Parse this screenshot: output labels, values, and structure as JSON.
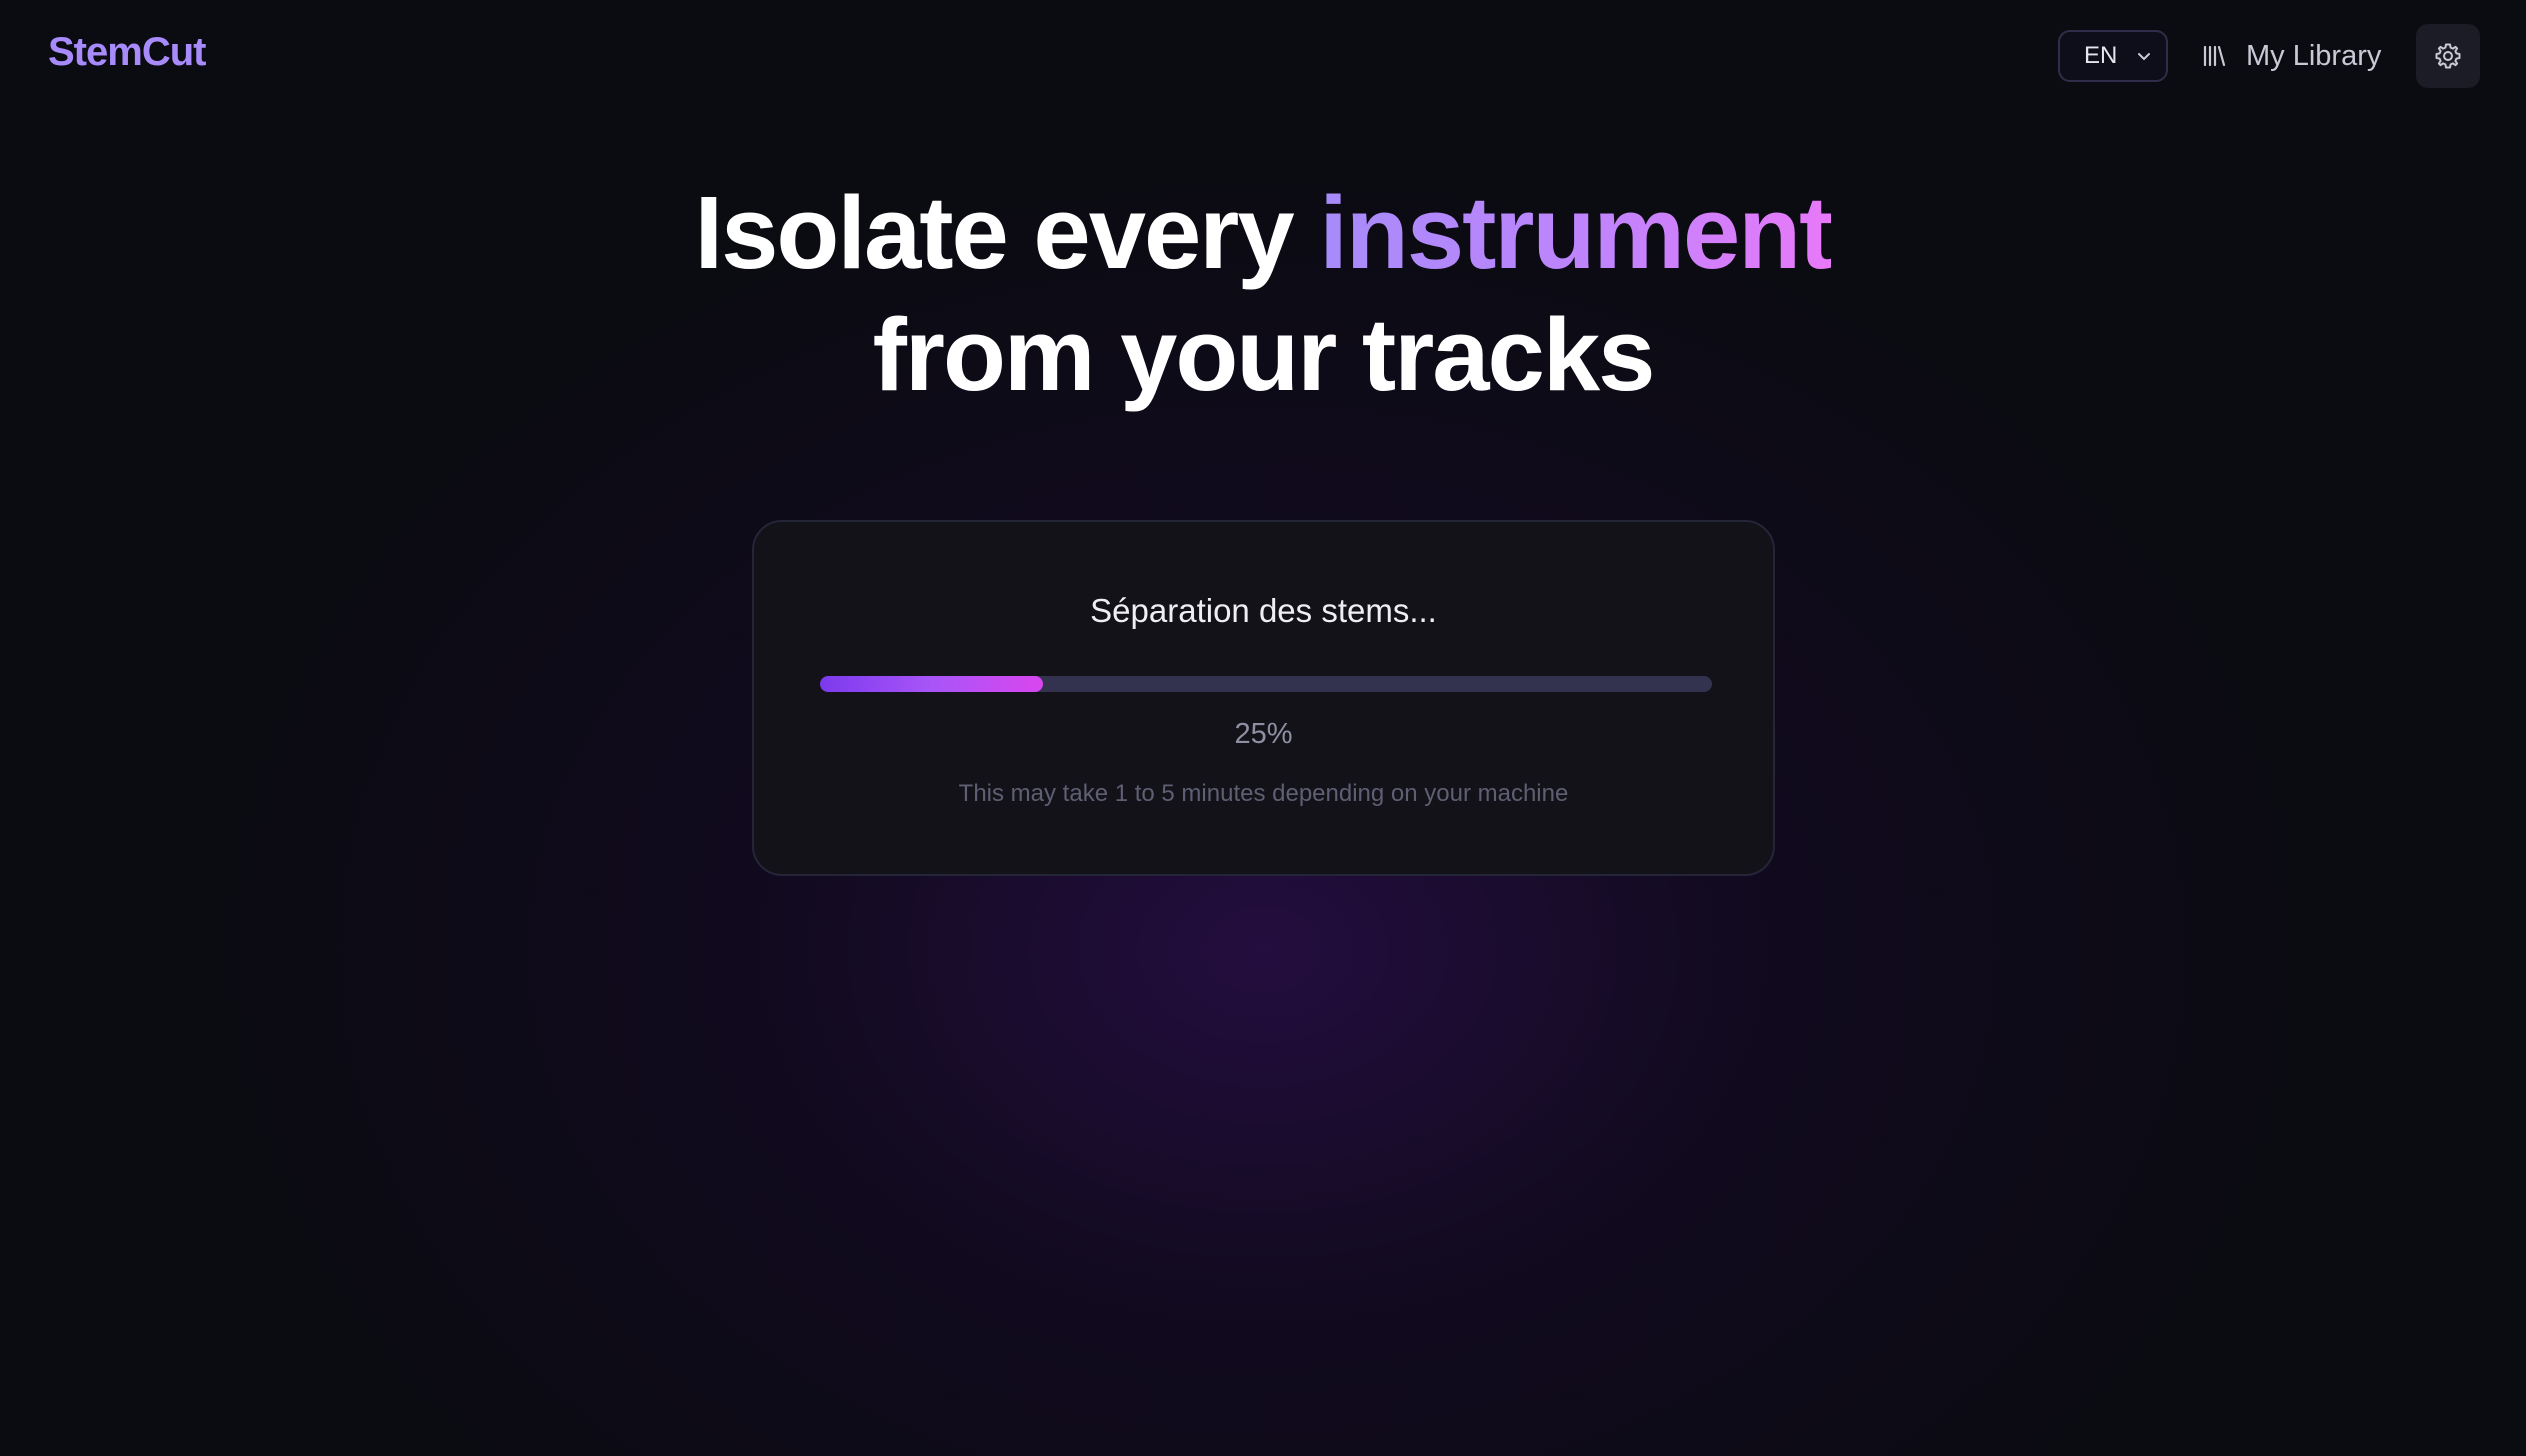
{
  "app": {
    "logo": "StemCut"
  },
  "header": {
    "language": {
      "selected": "EN"
    },
    "library_label": "My Library",
    "icons": {
      "library": "library-icon",
      "settings": "gear-icon",
      "chevron": "chevron-down-icon"
    }
  },
  "hero": {
    "line1_prefix": "Isolate every",
    "line1_accent": "instrument",
    "line2": "from your tracks"
  },
  "progress_card": {
    "title": "Séparation des stems...",
    "percent_value": 25,
    "percent_label": "25%",
    "hint": "This may take 1 to 5 minutes depending on your machine"
  },
  "colors": {
    "background": "#0b0b12",
    "accent": "#a78bfa",
    "accent_pink": "#e879f9",
    "progress_track": "#33334f"
  }
}
